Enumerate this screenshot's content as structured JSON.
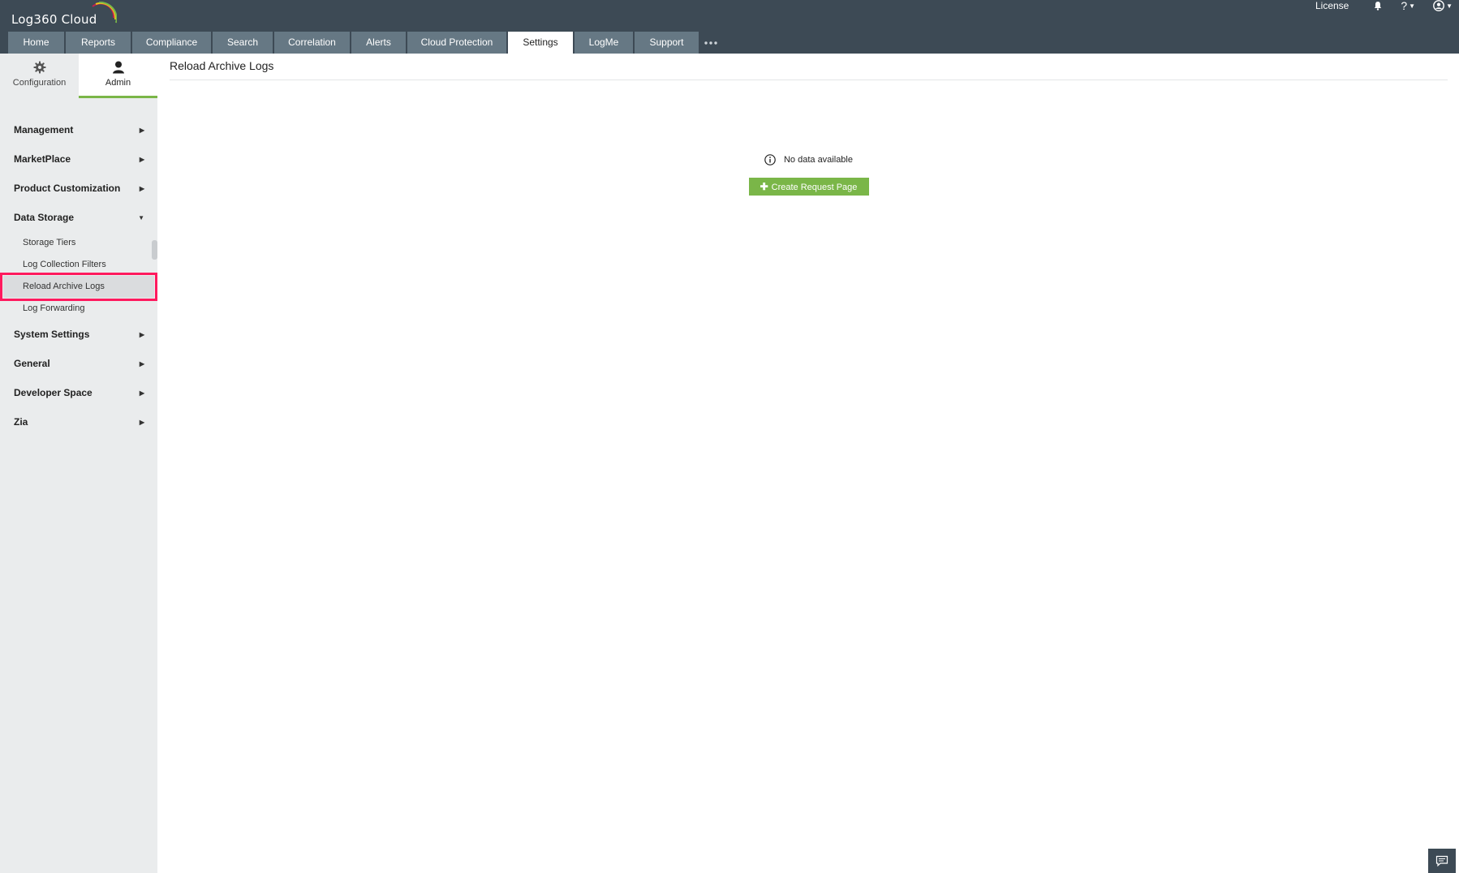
{
  "app": {
    "logo_text": "Log360  Cloud"
  },
  "header": {
    "license_label": "License",
    "icons": [
      "bell-icon",
      "help-icon",
      "user-icon"
    ],
    "help_glyph": "?"
  },
  "tabs": [
    {
      "label": "Home",
      "active": false
    },
    {
      "label": "Reports",
      "active": false
    },
    {
      "label": "Compliance",
      "active": false
    },
    {
      "label": "Search",
      "active": false
    },
    {
      "label": "Correlation",
      "active": false
    },
    {
      "label": "Alerts",
      "active": false
    },
    {
      "label": "Cloud Protection",
      "active": false
    },
    {
      "label": "Settings",
      "active": true
    },
    {
      "label": "LogMe",
      "active": false
    },
    {
      "label": "Support",
      "active": false
    }
  ],
  "sidebar": {
    "tabs": [
      {
        "label": "Configuration",
        "icon": "gear-icon",
        "active": false
      },
      {
        "label": "Admin",
        "icon": "user-icon",
        "active": true
      }
    ],
    "menu": [
      {
        "label": "Management",
        "expanded": false
      },
      {
        "label": "MarketPlace",
        "expanded": false
      },
      {
        "label": "Product Customization",
        "expanded": false
      },
      {
        "label": "Data Storage",
        "expanded": true,
        "items": [
          {
            "label": "Storage Tiers",
            "selected": false
          },
          {
            "label": "Log Collection Filters",
            "selected": false
          },
          {
            "label": "Reload Archive Logs",
            "selected": true
          },
          {
            "label": "Log Forwarding",
            "selected": false
          }
        ]
      },
      {
        "label": "System Settings",
        "expanded": false
      },
      {
        "label": "General",
        "expanded": false
      },
      {
        "label": "Developer Space",
        "expanded": false
      },
      {
        "label": "Zia",
        "expanded": false
      }
    ]
  },
  "content": {
    "title": "Reload Archive Logs",
    "empty_message": "No data available",
    "create_button_label": "Create Request Page"
  },
  "colors": {
    "header_bg": "#3d4a55",
    "tab_bg": "#667884",
    "accent_green": "#7ab648",
    "highlight_box": "#ff1a5e"
  }
}
